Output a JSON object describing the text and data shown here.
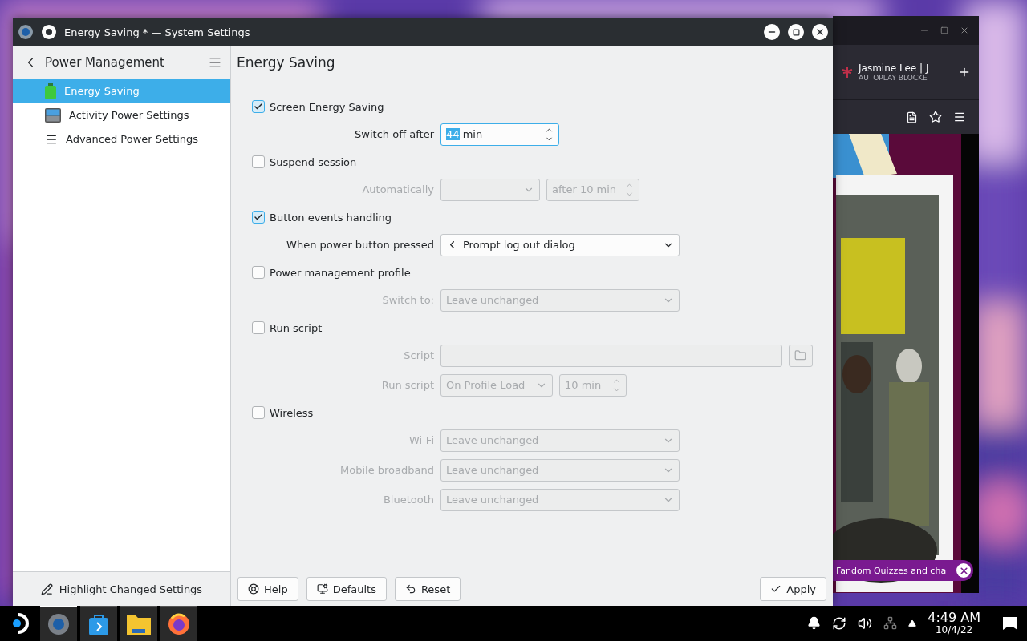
{
  "browser_window": {
    "tab": {
      "title": "Jasmine Lee | J",
      "subtitle": "AUTOPLAY BLOCKE"
    },
    "banner": "Fandom Quizzes and cha"
  },
  "settings_window": {
    "title": "Energy Saving * — System Settings",
    "sidebar": {
      "header": "Power Management",
      "items": [
        {
          "label": "Energy Saving",
          "kind": "battery",
          "selected": true
        },
        {
          "label": "Activity Power Settings",
          "kind": "screen",
          "selected": false
        },
        {
          "label": "Advanced Power Settings",
          "kind": "list",
          "selected": false
        }
      ],
      "footer_button": "Highlight Changed Settings"
    },
    "page": {
      "title": "Energy Saving",
      "sections": [
        {
          "label": "Screen Energy Saving",
          "checked": true,
          "rows": [
            {
              "label": "Switch off after",
              "controls": [
                {
                  "kind": "spin",
                  "value": "44",
                  "unit": "min",
                  "text_selected": true
                }
              ]
            }
          ]
        },
        {
          "label": "Suspend session",
          "checked": false,
          "rows": [
            {
              "label": "Automatically",
              "controls": [
                {
                  "kind": "small-combo"
                },
                {
                  "kind": "small-spin",
                  "value": "after 10 min"
                }
              ]
            }
          ]
        },
        {
          "label": "Button events handling",
          "checked": true,
          "rows": [
            {
              "label": "When power button pressed",
              "controls": [
                {
                  "kind": "action-combo",
                  "value": "Prompt log out dialog"
                }
              ]
            }
          ]
        },
        {
          "label": "Power management profile",
          "checked": false,
          "rows": [
            {
              "label": "Switch to:",
              "controls": [
                {
                  "kind": "combo",
                  "value": "Leave unchanged"
                }
              ]
            }
          ]
        },
        {
          "label": "Run script",
          "checked": false,
          "rows": [
            {
              "label": "Script",
              "controls": [
                {
                  "kind": "path-field"
                },
                {
                  "kind": "browse-button"
                }
              ]
            },
            {
              "label": "Run script",
              "controls": [
                {
                  "kind": "small-combo",
                  "value": "On Profile Load"
                },
                {
                  "kind": "small-spin",
                  "value": "10 min"
                }
              ]
            }
          ]
        },
        {
          "label": "Wireless",
          "checked": false,
          "rows": [
            {
              "label": "Wi-Fi",
              "controls": [
                {
                  "kind": "combo",
                  "value": "Leave unchanged"
                }
              ]
            },
            {
              "label": "Mobile broadband",
              "controls": [
                {
                  "kind": "combo",
                  "value": "Leave unchanged"
                }
              ]
            },
            {
              "label": "Bluetooth",
              "controls": [
                {
                  "kind": "combo",
                  "value": "Leave unchanged"
                }
              ]
            }
          ]
        }
      ]
    },
    "buttons": [
      {
        "label": "Help",
        "kind": "help"
      },
      {
        "label": "Defaults",
        "kind": "defaults"
      },
      {
        "label": "Reset",
        "kind": "reset"
      },
      {
        "label": "Apply",
        "kind": "apply"
      }
    ]
  },
  "taskbar": {
    "apps": [
      {
        "kind": "settings",
        "selected": true
      },
      {
        "kind": "store",
        "selected": false
      },
      {
        "kind": "files",
        "selected": false
      },
      {
        "kind": "browser",
        "selected": false
      }
    ],
    "clock": {
      "time": "4:49 AM",
      "date": "10/4/22"
    }
  }
}
